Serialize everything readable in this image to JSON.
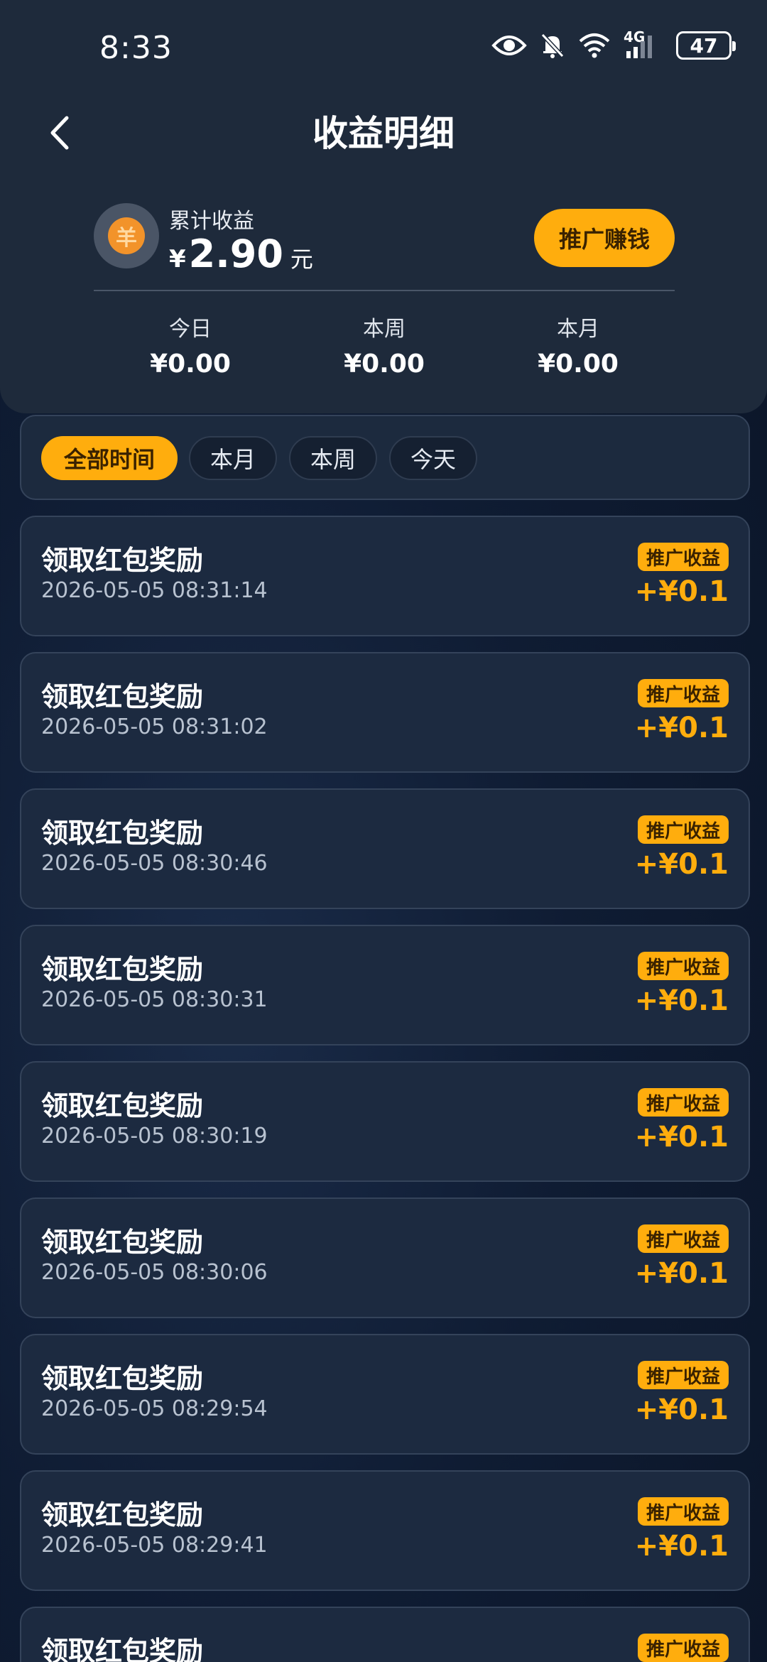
{
  "status_bar": {
    "time": "8:33",
    "network": "4G",
    "battery": "47"
  },
  "header": {
    "title": "收益明细",
    "coin_symbol": "羊",
    "total_label": "累计收益",
    "currency": "¥",
    "total_value": "2.90",
    "total_unit": "元",
    "promote_label": "推广赚钱"
  },
  "stats": [
    {
      "label": "今日",
      "value": "¥0.00"
    },
    {
      "label": "本周",
      "value": "¥0.00"
    },
    {
      "label": "本月",
      "value": "¥0.00"
    }
  ],
  "filters": [
    {
      "label": "全部时间",
      "active": true
    },
    {
      "label": "本月",
      "active": false
    },
    {
      "label": "本周",
      "active": false
    },
    {
      "label": "今天",
      "active": false
    }
  ],
  "records": [
    {
      "title": "领取红包奖励",
      "time": "2026-05-05 08:31:14",
      "badge": "推广收益",
      "amount": "+¥0.1"
    },
    {
      "title": "领取红包奖励",
      "time": "2026-05-05 08:31:02",
      "badge": "推广收益",
      "amount": "+¥0.1"
    },
    {
      "title": "领取红包奖励",
      "time": "2026-05-05 08:30:46",
      "badge": "推广收益",
      "amount": "+¥0.1"
    },
    {
      "title": "领取红包奖励",
      "time": "2026-05-05 08:30:31",
      "badge": "推广收益",
      "amount": "+¥0.1"
    },
    {
      "title": "领取红包奖励",
      "time": "2026-05-05 08:30:19",
      "badge": "推广收益",
      "amount": "+¥0.1"
    },
    {
      "title": "领取红包奖励",
      "time": "2026-05-05 08:30:06",
      "badge": "推广收益",
      "amount": "+¥0.1"
    },
    {
      "title": "领取红包奖励",
      "time": "2026-05-05 08:29:54",
      "badge": "推广收益",
      "amount": "+¥0.1"
    },
    {
      "title": "领取红包奖励",
      "time": "2026-05-05 08:29:41",
      "badge": "推广收益",
      "amount": "+¥0.1"
    },
    {
      "title": "领取红包奖励",
      "time": "",
      "badge": "推广收益",
      "amount": ""
    }
  ],
  "colors": {
    "accent": "#ffad0d",
    "header_bg": "#1e2a3b",
    "card_bg": "#1c2a40"
  }
}
